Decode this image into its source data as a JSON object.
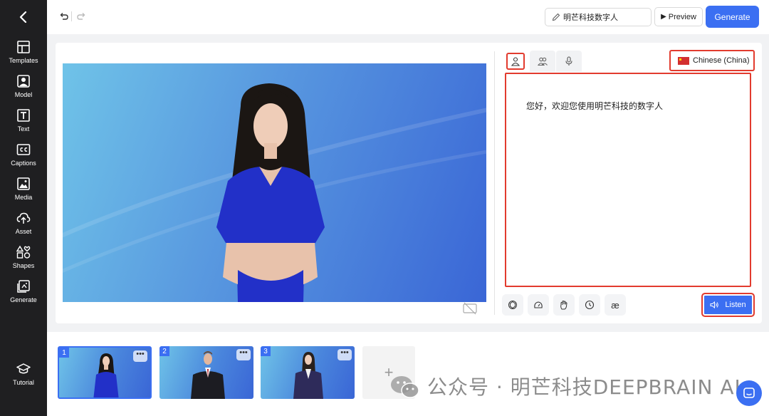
{
  "sidebar": {
    "items": [
      {
        "label": "Templates",
        "icon": "templates-icon"
      },
      {
        "label": "Model",
        "icon": "model-icon"
      },
      {
        "label": "Text",
        "icon": "text-icon"
      },
      {
        "label": "Captions",
        "icon": "captions-icon"
      },
      {
        "label": "Media",
        "icon": "media-icon"
      },
      {
        "label": "Asset",
        "icon": "upload-icon"
      },
      {
        "label": "Shapes",
        "icon": "shapes-icon"
      },
      {
        "label": "Generate",
        "icon": "generate-icon"
      }
    ],
    "tutorial_label": "Tutorial"
  },
  "header": {
    "project_name": "明芒科技数字人",
    "preview_label": "Preview",
    "generate_label": "Generate"
  },
  "editor": {
    "language": "Chinese (China)",
    "script_text": "您好，欢迎您使用明芒科技的数字人",
    "tools": [
      "gpt-icon",
      "speed-icon",
      "gesture-icon",
      "pause-icon"
    ],
    "phoneme_symbol": "æ",
    "listen_label": "Listen"
  },
  "scenes": [
    {
      "num": "1",
      "more": "•••"
    },
    {
      "num": "2",
      "more": "•••"
    },
    {
      "num": "3",
      "more": "•••"
    }
  ],
  "add_scene_symbol": "+",
  "watermark": "公众号 · 明芒科技DEEPBRAIN AI",
  "colors": {
    "accent": "#3b6ff2",
    "highlight": "#e23b2e",
    "sidebar": "#1f1f21"
  }
}
